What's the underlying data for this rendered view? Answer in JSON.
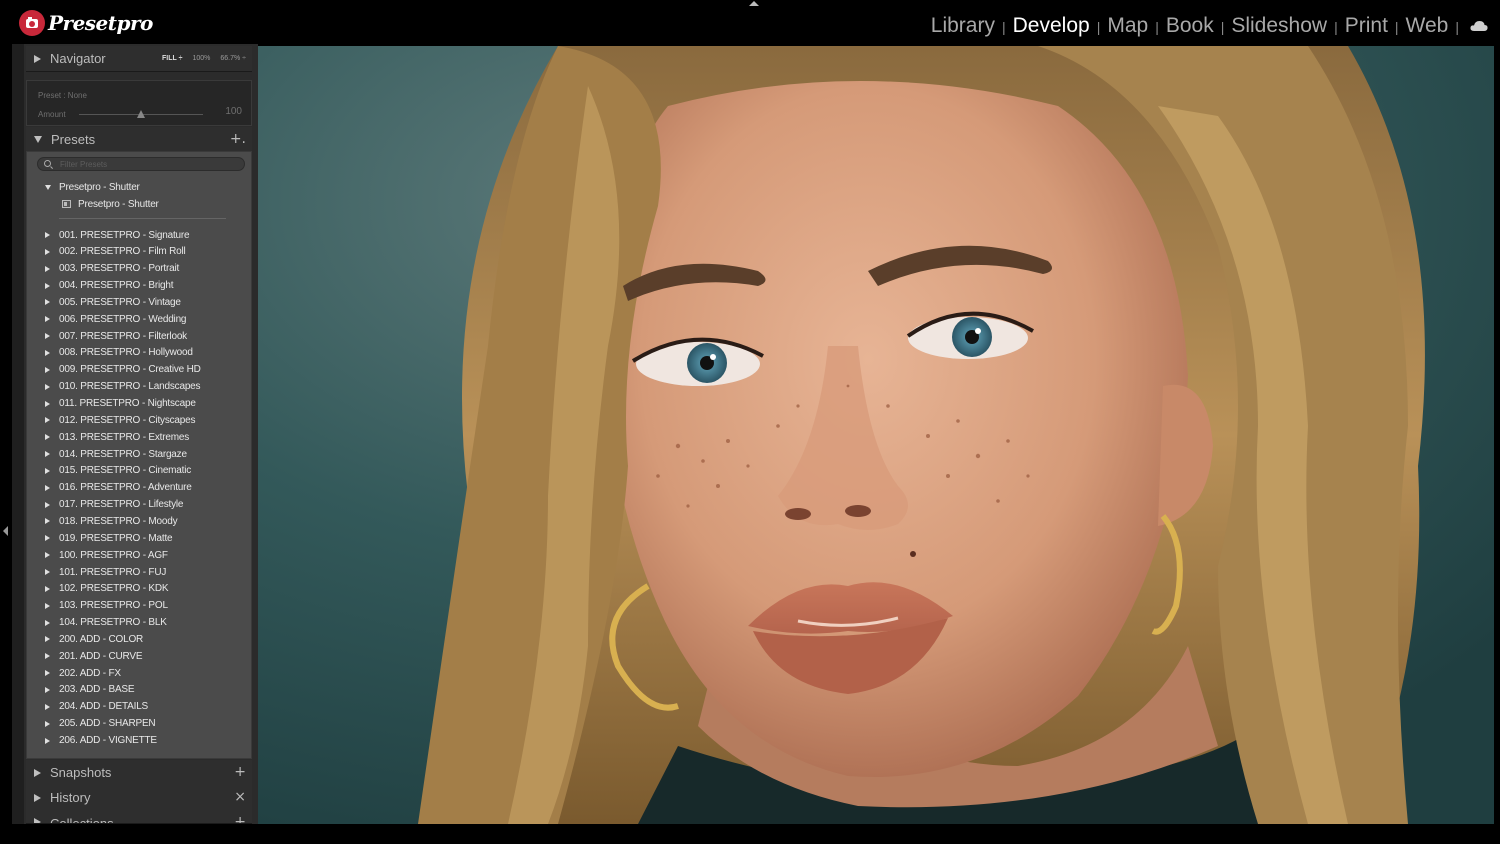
{
  "app": {
    "logo_text": "Presetpro",
    "logo_icon": "camera-icon"
  },
  "modules": [
    {
      "label": "Library",
      "active": false
    },
    {
      "label": "Develop",
      "active": true
    },
    {
      "label": "Map",
      "active": false
    },
    {
      "label": "Book",
      "active": false
    },
    {
      "label": "Slideshow",
      "active": false
    },
    {
      "label": "Print",
      "active": false
    },
    {
      "label": "Web",
      "active": false
    }
  ],
  "module_separator": "|",
  "navigator": {
    "title": "Navigator",
    "zoom_fill": "FILL ÷",
    "zoom_100": "100%",
    "zoom_custom": "66.7% ÷"
  },
  "preset_amount": {
    "preset_label": "Preset : None",
    "amount_label": "Amount",
    "amount_value": "100",
    "amount_fraction": 0.5
  },
  "presets": {
    "title": "Presets",
    "add_symbol": "+.",
    "filter_placeholder": "Filter Presets",
    "expanded_folder": "Presetpro - Shutter",
    "expanded_preset": "Presetpro - Shutter",
    "folders": [
      "001. PRESETPRO - Signature",
      "002. PRESETPRO - Film Roll",
      "003. PRESETPRO - Portrait",
      "004. PRESETPRO - Bright",
      "005. PRESETPRO - Vintage",
      "006. PRESETPRO - Wedding",
      "007. PRESETPRO - Filterlook",
      "008. PRESETPRO - Hollywood",
      "009. PRESETPRO - Creative HD",
      "010. PRESETPRO - Landscapes",
      "011. PRESETPRO - Nightscape",
      "012. PRESETPRO - Cityscapes",
      "013. PRESETPRO - Extremes",
      "014. PRESETPRO - Stargaze",
      "015. PRESETPRO - Cinematic",
      "016. PRESETPRO - Adventure",
      "017. PRESETPRO - Lifestyle",
      "018. PRESETPRO - Moody",
      "019. PRESETPRO - Matte",
      "100. PRESETPRO - AGF",
      "101. PRESETPRO - FUJ",
      "102. PRESETPRO - KDK",
      "103. PRESETPRO - POL",
      "104. PRESETPRO - BLK",
      "200. ADD - COLOR",
      "201. ADD - CURVE",
      "202. ADD - FX",
      "203. ADD - BASE",
      "204. ADD - DETAILS",
      "205. ADD - SHARPEN",
      "206. ADD - VIGNETTE"
    ]
  },
  "snapshots": {
    "title": "Snapshots",
    "action": "+"
  },
  "history": {
    "title": "History",
    "action": "×"
  },
  "collections": {
    "title": "Collections",
    "action": "+"
  },
  "colors": {
    "accent_red": "#c8283a",
    "panel": "#2b2b2b",
    "preset_list_bg": "#4b4b4b",
    "photo_bg": "#2f5152"
  }
}
